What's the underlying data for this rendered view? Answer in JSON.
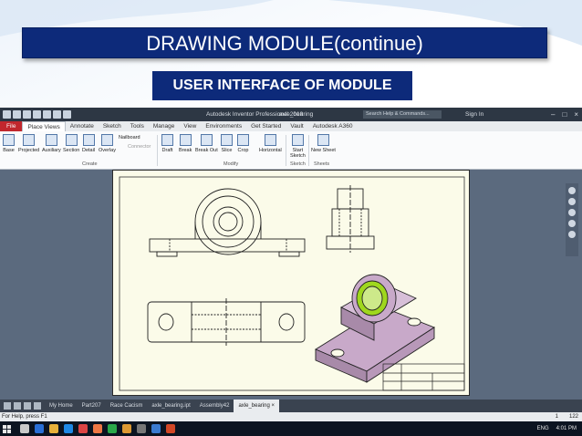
{
  "slide": {
    "title": "DRAWING MODULE(continue)",
    "subtitle": "USER INTERFACE OF MODULE"
  },
  "app": {
    "window_title": "Autodesk Inventor Professional 2018",
    "file_name": "axle_bearing",
    "search_placeholder": "Search Help & Commands...",
    "sign_in": "Sign In",
    "menu_tabs": [
      "File",
      "Place Views",
      "Annotate",
      "Sketch",
      "Tools",
      "Manage",
      "View",
      "Environments",
      "Get Started",
      "Vault",
      "Autodesk A360"
    ],
    "active_tab": "Place Views",
    "ribbon": {
      "create": {
        "label": "Create",
        "buttons": [
          "Base",
          "Projected",
          "Auxiliary",
          "Section",
          "Detail",
          "Overlay"
        ],
        "nailboard": "Nailboard",
        "connector": "Connector"
      },
      "modify": {
        "label": "Modify",
        "buttons": [
          "Draft",
          "Break",
          "Break Out",
          "Slice",
          "Crop"
        ],
        "horizontal": "Horizontal"
      },
      "sketch": {
        "label": "Sketch",
        "start_sketch_line1": "Start",
        "start_sketch_line2": "Sketch"
      },
      "sheets": {
        "label": "Sheets",
        "new_sheet": "New Sheet"
      }
    },
    "doc_tabs": [
      "My Home",
      "Part207",
      "Race Cacism",
      "axle_bearing.ipt",
      "Assembly42",
      "axle_bearing"
    ],
    "active_doc": "axle_bearing",
    "status_text": "For Help, press F1",
    "status_right_1": "1",
    "status_right_2": "122",
    "tray": {
      "lang": "ENG",
      "time": "4:01 PM"
    }
  },
  "colors": {
    "slide_title_bg": "#0d2a7a",
    "file_tab": "#c1272d",
    "canvas_bg": "#5b6a7e",
    "sheet_bg": "#fbfbe9",
    "part_body": "#c8a9c9",
    "bushing": "#9fd71e"
  }
}
